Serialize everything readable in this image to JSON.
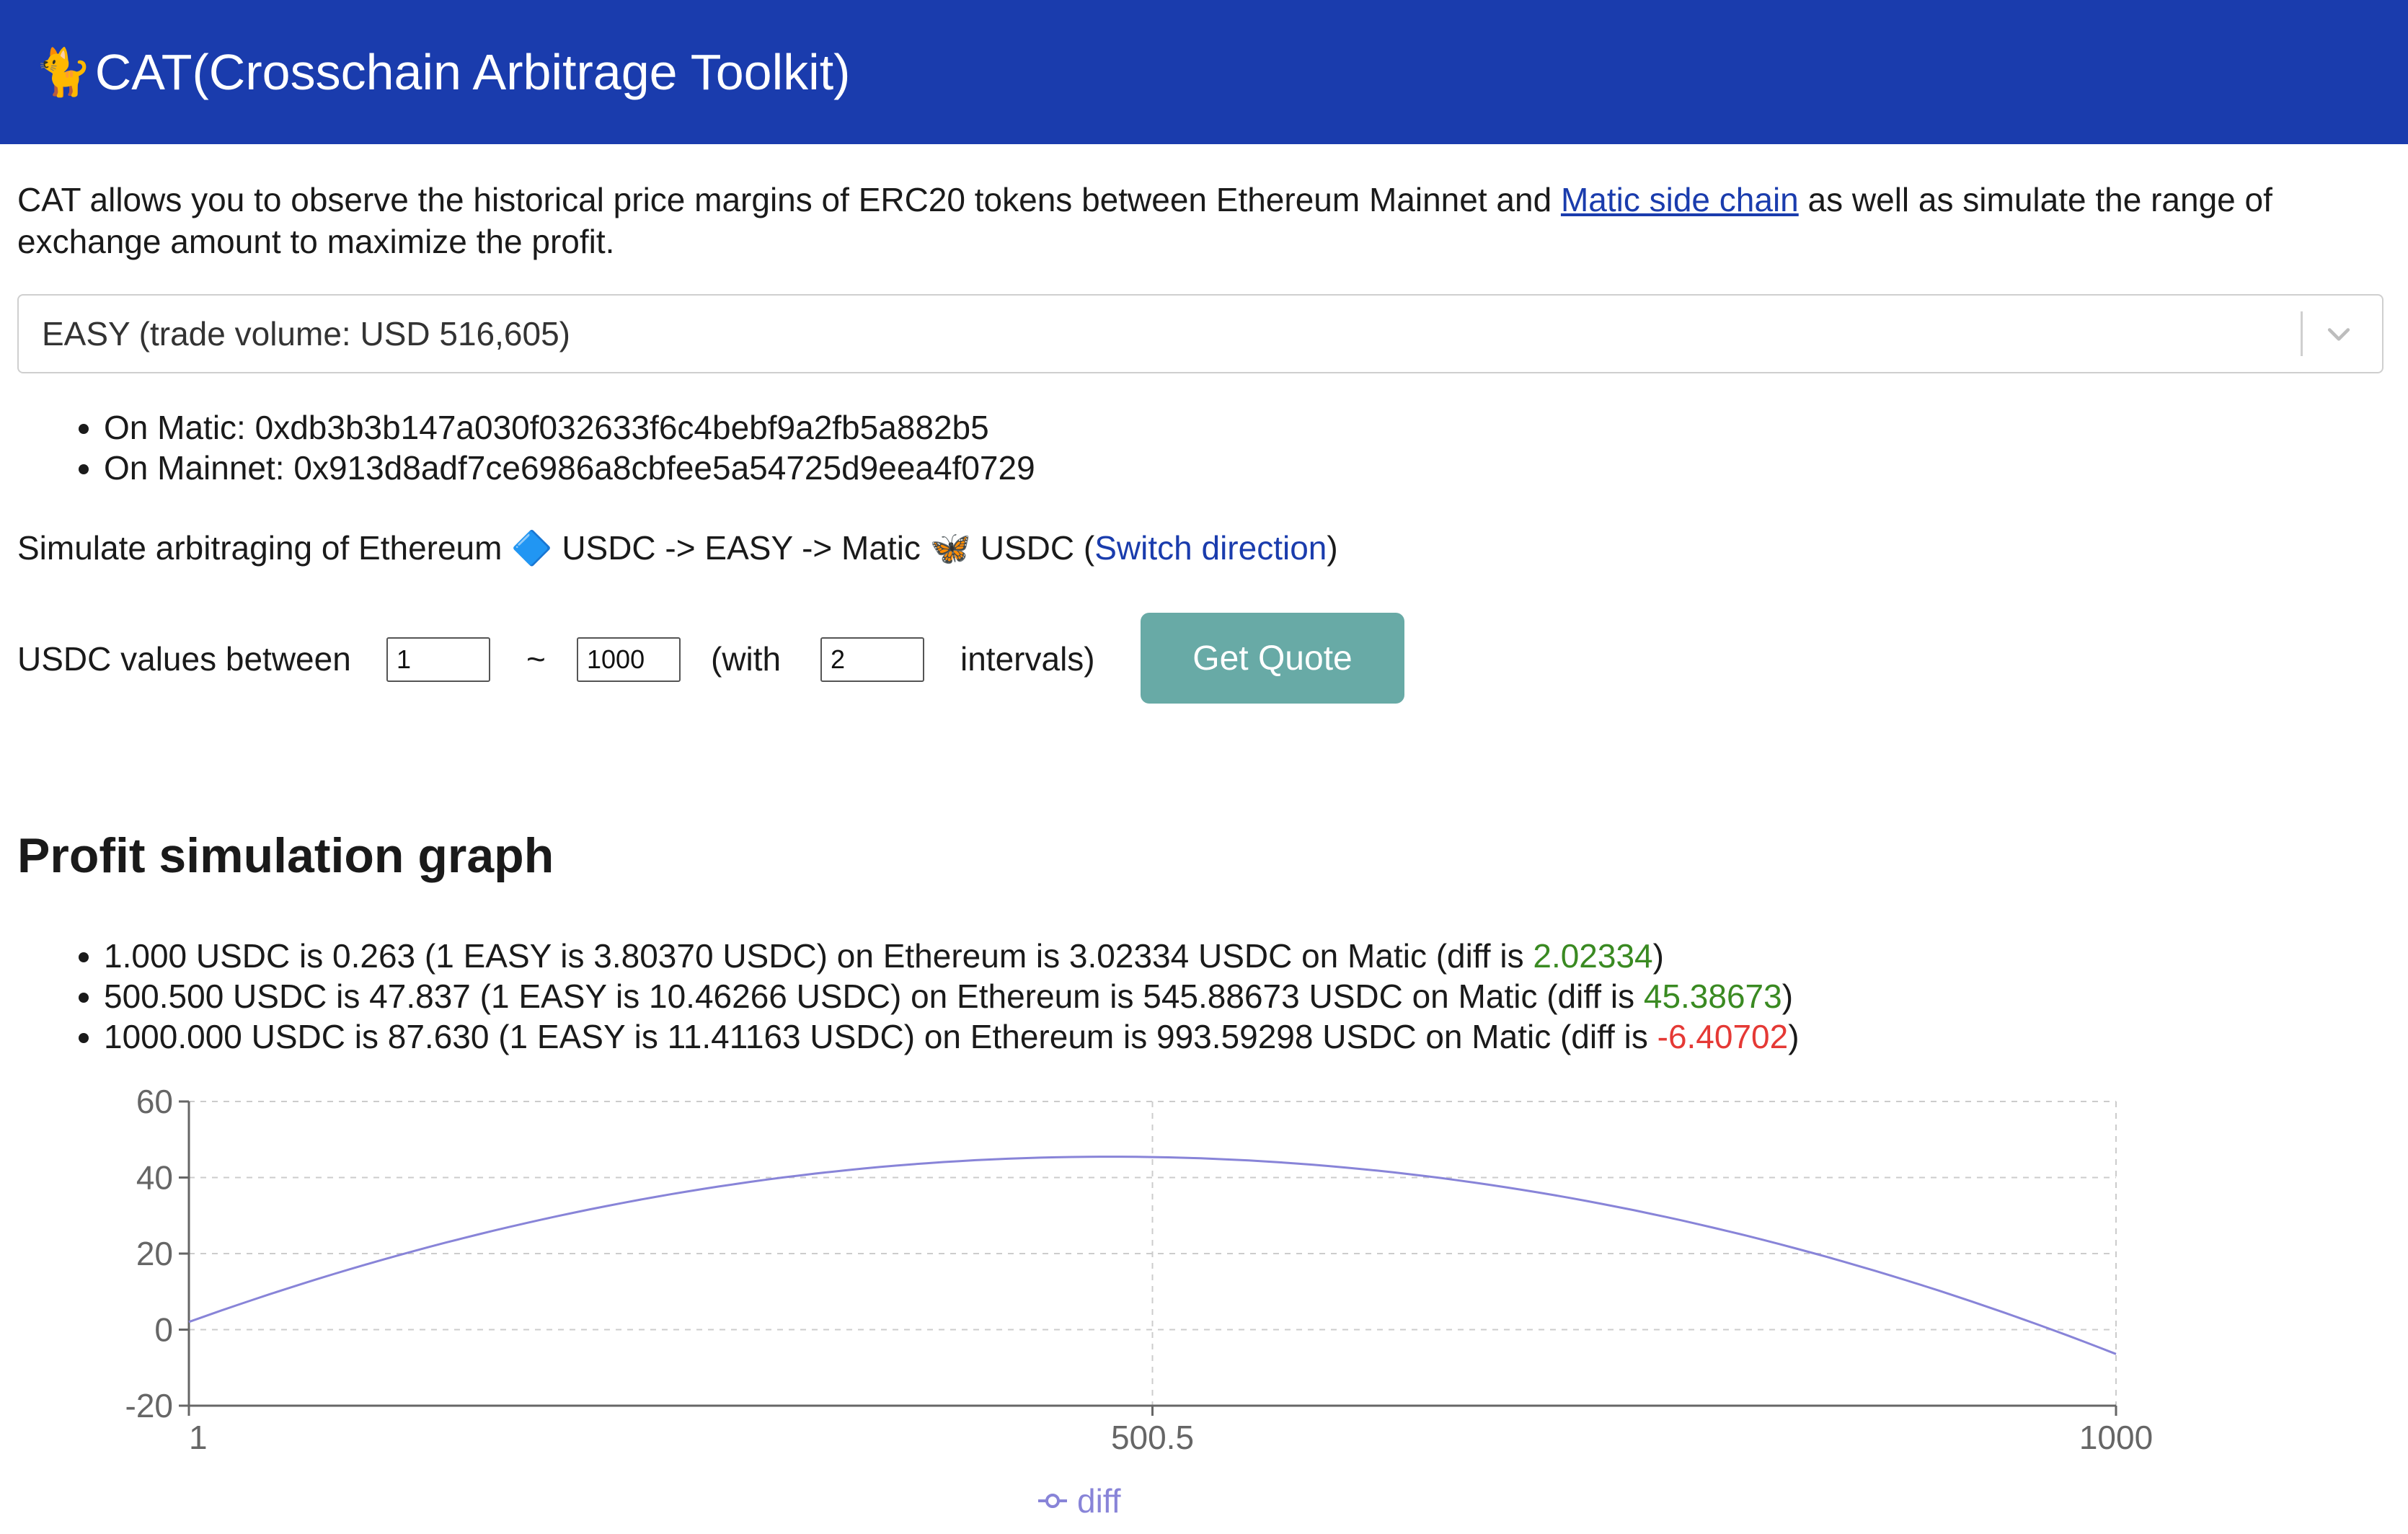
{
  "header": {
    "icon": "cat-icon",
    "cat_glyph": "🐈",
    "title": "CAT(Crosschain Arbitrage Toolkit)"
  },
  "intro": {
    "before": "CAT allows you to observe the historical price margins of ERC20 tokens between Ethereum Mainnet and ",
    "link": "Matic side chain",
    "after": " as well as simulate the range of exchange amount to maximize the profit."
  },
  "token_select": {
    "value": "EASY (trade volume: USD 516,605)"
  },
  "addresses": [
    "On Matic: 0xdb3b3b147a030f032633f6c4bebf9a2fb5a882b5",
    "On Mainnet: 0x913d8adf7ce6986a8cbfee5a54725d9eea4f0729"
  ],
  "simulate": {
    "prefix": "Simulate arbitraging of Ethereum",
    "eth_glyph": "🔷",
    "middle": "USDC -> EASY -> Matic",
    "matic_glyph": "🦋",
    "suffix": "USDC (",
    "switch_label": "Switch direction",
    "close": ")"
  },
  "controls": {
    "label_between": "USDC values between",
    "min_value": "1",
    "tilde": "~",
    "max_value": "1000",
    "label_with": "(with",
    "intervals_value": "2",
    "label_intervals": "intervals)",
    "button": "Get Quote"
  },
  "graph_title": "Profit simulation graph",
  "results": [
    {
      "text": "1.000 USDC is 0.263 (1 EASY is 3.80370 USDC) on Ethereum is 3.02334 USDC on Matic (diff is ",
      "diff": "2.02334",
      "sign": "pos",
      "end": ")"
    },
    {
      "text": "500.500 USDC is 47.837 (1 EASY is 10.46266 USDC) on Ethereum is 545.88673 USDC on Matic (diff is ",
      "diff": "45.38673",
      "sign": "pos",
      "end": ")"
    },
    {
      "text": "1000.000 USDC is 87.630 (1 EASY is 11.41163 USDC) on Ethereum is 993.59298 USDC on Matic (diff is ",
      "diff": "-6.40702",
      "sign": "neg",
      "end": ")"
    }
  ],
  "colors": {
    "header": "#1a3cad",
    "button": "#68aaa6",
    "line": "#8884d8",
    "positive": "#3a8a22",
    "negative": "#e53935"
  },
  "chart_data": {
    "type": "line",
    "x": [
      1,
      500.5,
      1000
    ],
    "series": [
      {
        "name": "diff",
        "values": [
          2.02334,
          45.38673,
          -6.40702
        ]
      }
    ],
    "xticks": [
      "1",
      "500.5",
      "1000"
    ],
    "yticks": [
      -20,
      0,
      20,
      40,
      60
    ],
    "xlim": [
      1,
      1000
    ],
    "ylim": [
      -20,
      60
    ],
    "grid": true,
    "legend": "bottom-center"
  }
}
